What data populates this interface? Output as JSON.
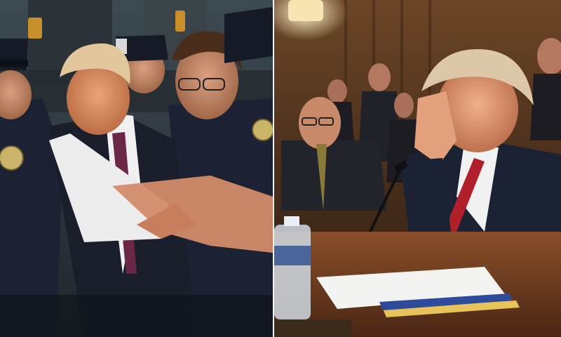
{
  "panels": [
    {
      "id": "left",
      "accessible_description_source": "left-panel"
    },
    {
      "id": "right",
      "accessible_description_source": "right-panel"
    }
  ],
  "colors": {
    "divider": "#f2f2f2",
    "police_uniform": "#1c2233",
    "suit_dark": "#1a1e2b",
    "skin": "#d9946a",
    "hair_blond": "#e3c79c",
    "wood": "#5a3a22",
    "table": "#6b3a1f",
    "tie_red": "#b01f2a"
  }
}
